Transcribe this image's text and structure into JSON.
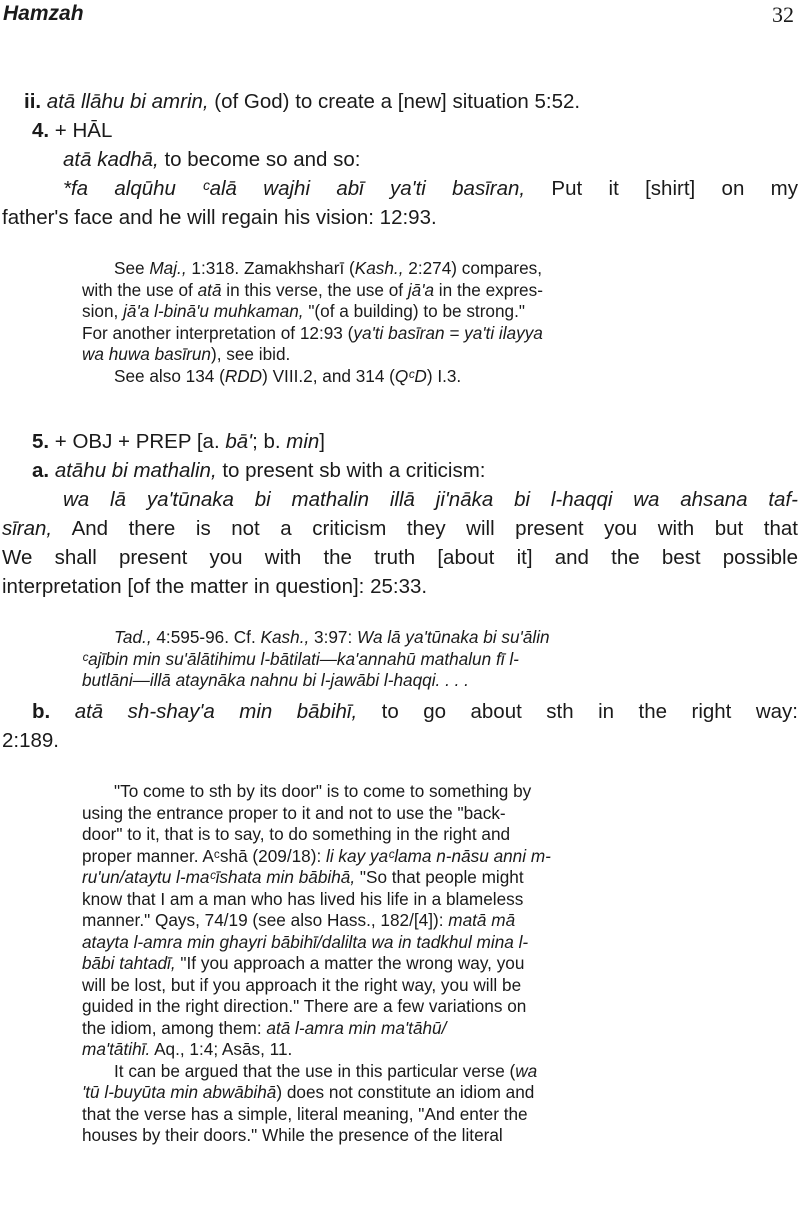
{
  "header": {
    "running_title": "Hamzah",
    "page_number": "32"
  },
  "body": {
    "ii_num": "ii.",
    "ii_phrase": "atā llāhu bi amrin,",
    "ii_gloss": " (of God) to create a [new] situation 5:52.",
    "s4_num": "4.",
    "s4_head": " + HĀL",
    "s4_phrase": "atā kadhā,",
    "s4_gloss": " to become so and so:",
    "s4_ex_it": "*fa alqūhu ᶜalā wajhi abī ya'ti basīran,",
    "s4_ex_tr1": " Put it [shirt] on my",
    "s4_ex_tr2": "father's face and he will regain his vision: 12:93.",
    "note1": {
      "l1a": "See ",
      "l1b": "Maj.,",
      "l1c": " 1:318. Zamakhsharī (",
      "l1d": "Kash.,",
      "l1e": " 2:274) compares,",
      "l2a": "with the use of ",
      "l2b": "atā",
      "l2c": " in this verse, the use of ",
      "l2d": "jā'a",
      "l2e": " in the expres-",
      "l3a": "sion, ",
      "l3b": "jā'a l-binā'u muhkaman,",
      "l3c": " \"(of a building) to be strong.\"",
      "l4a": "For another interpretation of 12:93 (",
      "l4b": "ya'ti basīran = ya'ti ilayya",
      "l5a": "wa huwa basīrun",
      "l5b": "), see ibid.",
      "l6a": "See also 134 (",
      "l6b": "RDD",
      "l6c": ") VIII.2, and 314 (",
      "l6d": "QᶜD",
      "l6e": ") I.3."
    },
    "s5_num": "5.",
    "s5_head_a": " + OBJ + PREP [a. ",
    "s5_head_b": "bā'",
    "s5_head_c": "; b. ",
    "s5_head_d": "min",
    "s5_head_e": "]",
    "a_num": "a.",
    "a_phrase": "atāhu bi mathalin,",
    "a_gloss": " to present sb with a criticism:",
    "a_ex_it1": "wa lā ya'tūnaka bi mathalin illā ji'nāka bi l-haqqi wa ahsana taf-",
    "a_ex_it2": "sīran,",
    "a_ex_tr2": " And there is not a criticism they will present you with but that",
    "a_ex_tr3": "We shall present you with the truth [about it] and the best possible",
    "a_ex_tr4": "interpretation [of the matter in question]: 25:33.",
    "note2": {
      "l1a": "Tad.,",
      "l1b": " 4:595-96. Cf. ",
      "l1c": "Kash.,",
      "l1d": " 3:97: ",
      "l1e": "Wa lā ya'tūnaka bi su'ālin",
      "l2": "ᶜajībin min su'ālātihimu l-bātilati—ka'annahū mathalun fī l-",
      "l3": "butlāni—illā ataynāka nahnu bi l-jawābi l-haqqi. . . ."
    },
    "b_num": "b.",
    "b_phrase": "atā sh-shay'a min bābihī,",
    "b_gloss": " to go about sth in the right way:",
    "b_ref": "2:189.",
    "note3": {
      "p1": [
        "\"To come to sth by its door\" is to come to something by",
        "using the entrance proper to it and not to use the \"back-",
        "door\" to it, that is to say, to do something in the right and"
      ],
      "p1_l4a": "proper manner. Aᶜshā (209/18): ",
      "p1_l4b": "li kay yaᶜlama n-nāsu anni m-",
      "p1_l5a": "ru'un/ataytu l-maᶜīshata min bābihā,",
      "p1_l5b": " \"So that people might",
      "p1_l6": "know that I am a man who has lived his life in a blameless",
      "p1_l7a": "manner.\" Qays, 74/19 (see also Hass., 182/[4]): ",
      "p1_l7b": "matā mā",
      "p1_l8": "atayta l-amra min ghayri bābihī/dalilta wa in tadkhul mina l-",
      "p1_l9a": "bābi tahtadī,",
      "p1_l9b": " \"If you approach a matter the wrong way, you",
      "p1_l10": "will be lost, but if you approach it the right way, you will be",
      "p1_l11": "guided in the right direction.\" There are a few variations on",
      "p1_l12a": "the idiom, among them: ",
      "p1_l12b": "atā l-amra min ma'tāhū/",
      "p1_l13a": "ma'tātihī.",
      "p1_l13b": " Aq., 1:4; Asās, 11.",
      "p2_l1a": "It can be argued that the use in this particular verse (",
      "p2_l1b": "wa",
      "p2_l2a": "'tū l-buyūta min abwābihā",
      "p2_l2b": ") does not constitute an idiom and",
      "p2_l3": "that the verse has a simple, literal meaning, \"And enter the",
      "p2_l4": "houses by their doors.\" While the presence of the literal"
    }
  }
}
